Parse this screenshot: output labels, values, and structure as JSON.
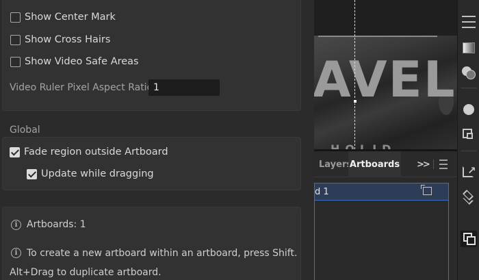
{
  "display": {
    "show_center_mark": {
      "label": "Show Center Mark",
      "checked": false
    },
    "show_cross_hairs": {
      "label": "Show Cross Hairs",
      "checked": false
    },
    "show_video_safe_areas": {
      "label": "Show Video Safe Areas",
      "checked": false
    },
    "video_ruler_label": "Video Ruler Pixel Aspect Ratio:",
    "video_ruler_value": "1"
  },
  "global": {
    "heading": "Global",
    "fade_region": {
      "label": "Fade region outside Artboard",
      "checked": true
    },
    "update_while_dragging": {
      "label": "Update while dragging",
      "checked": true
    }
  },
  "info": {
    "artboards_count": "Artboards: 1",
    "tip_line1": "To create a new artboard within an artboard, press Shift.",
    "tip_line2": "Alt+Drag to duplicate artboard."
  },
  "canvas": {
    "artwork_text": "AVEL",
    "artwork_subtext": "HOLID"
  },
  "layers_panel": {
    "tabs": [
      {
        "label": "Layers",
        "active": false
      },
      {
        "label": "Artboards",
        "active": true
      }
    ],
    "more_label": ">>",
    "artboard_row_name": "d 1",
    "selection_color": "#3f6fb5"
  },
  "toolbar": {
    "icons": [
      "hamburger-icon",
      "gradient-icon",
      "transparency-icon",
      "appearance-icon",
      "export-icon",
      "share-icon",
      "layers-icon",
      "artboards-icon"
    ]
  }
}
